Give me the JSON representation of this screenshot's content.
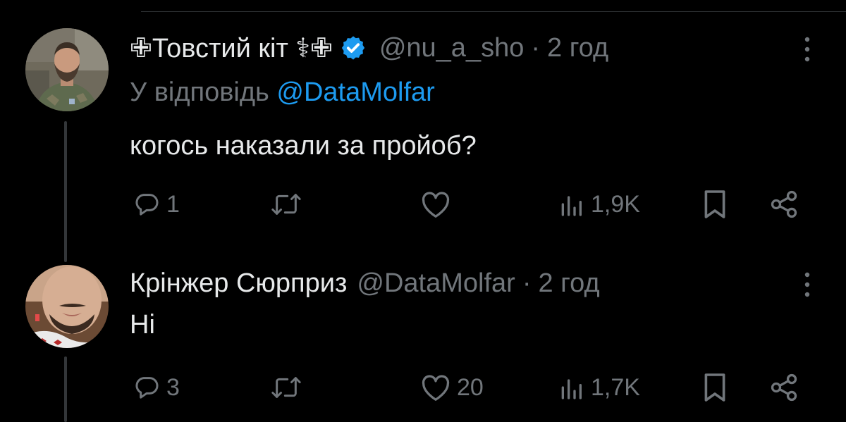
{
  "colors": {
    "background": "#000000",
    "text": "#e7e9ea",
    "muted": "#71767b",
    "accent": "#1d9bf0"
  },
  "tweets": [
    {
      "display_name": "✙Товстий кіт ⚕✙",
      "verified": true,
      "handle": "@nu_a_sho",
      "separator": "·",
      "time": "2 год",
      "reply_prefix": "У відповідь ",
      "reply_handle": "@DataMolfar",
      "text": "когось наказали за пройоб?",
      "replies": "1",
      "reposts": "",
      "likes": "",
      "views": "1,9K",
      "avatar": "avatar-soldier",
      "icons": [
        "reply-icon",
        "repost-icon",
        "like-icon",
        "views-icon",
        "bookmark-icon",
        "share-icon",
        "more-icon",
        "verified-badge-icon"
      ]
    },
    {
      "display_name": "Крінжер Сюрприз",
      "handle": "@DataMolfar",
      "separator": "·",
      "time": "2 год",
      "text": "Ні",
      "replies": "3",
      "reposts": "",
      "likes": "20",
      "views": "1,7K",
      "avatar": "avatar-face",
      "icons": [
        "reply-icon",
        "repost-icon",
        "like-icon",
        "views-icon",
        "bookmark-icon",
        "share-icon",
        "more-icon"
      ]
    }
  ]
}
